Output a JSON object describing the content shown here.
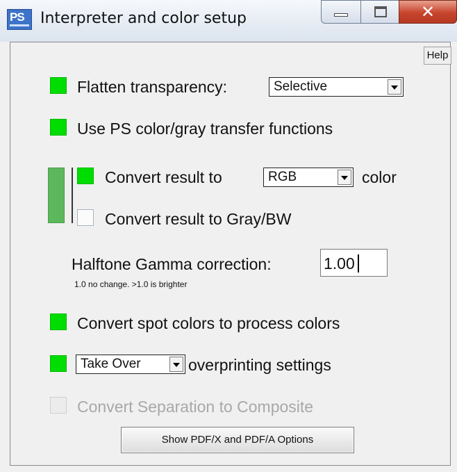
{
  "window": {
    "title": "Interpreter and color setup",
    "app_icon_text": "PS",
    "controls": [
      "minimize",
      "maximize",
      "close"
    ]
  },
  "help_label": "Help",
  "flatten": {
    "checked": true,
    "label": "Flatten transparency:",
    "selected": "Selective"
  },
  "ps_transfer": {
    "checked": true,
    "label": "Use PS color/gray transfer functions"
  },
  "convert_color": {
    "checked": true,
    "label_before": "Convert result to",
    "selected": "RGB",
    "label_after": "color"
  },
  "convert_gray": {
    "checked": false,
    "label": "Convert result to Gray/BW"
  },
  "gamma": {
    "label": "Halftone Gamma correction:",
    "value": "1.00",
    "hint": "1.0 no change. >1.0 is brighter"
  },
  "spot_colors": {
    "checked": true,
    "label": "Convert spot colors to process colors"
  },
  "overprint": {
    "checked": true,
    "selected": "Take Over",
    "label": "overprinting settings"
  },
  "separation": {
    "checked": false,
    "enabled": false,
    "label": "Convert Separation to Composite"
  },
  "pdfx_button_label": "Show PDF/X and PDF/A Options",
  "colors": {
    "checkbox_on": "#00dd00",
    "group_bar": "#5cb85c",
    "close_button": "#c7442c"
  }
}
